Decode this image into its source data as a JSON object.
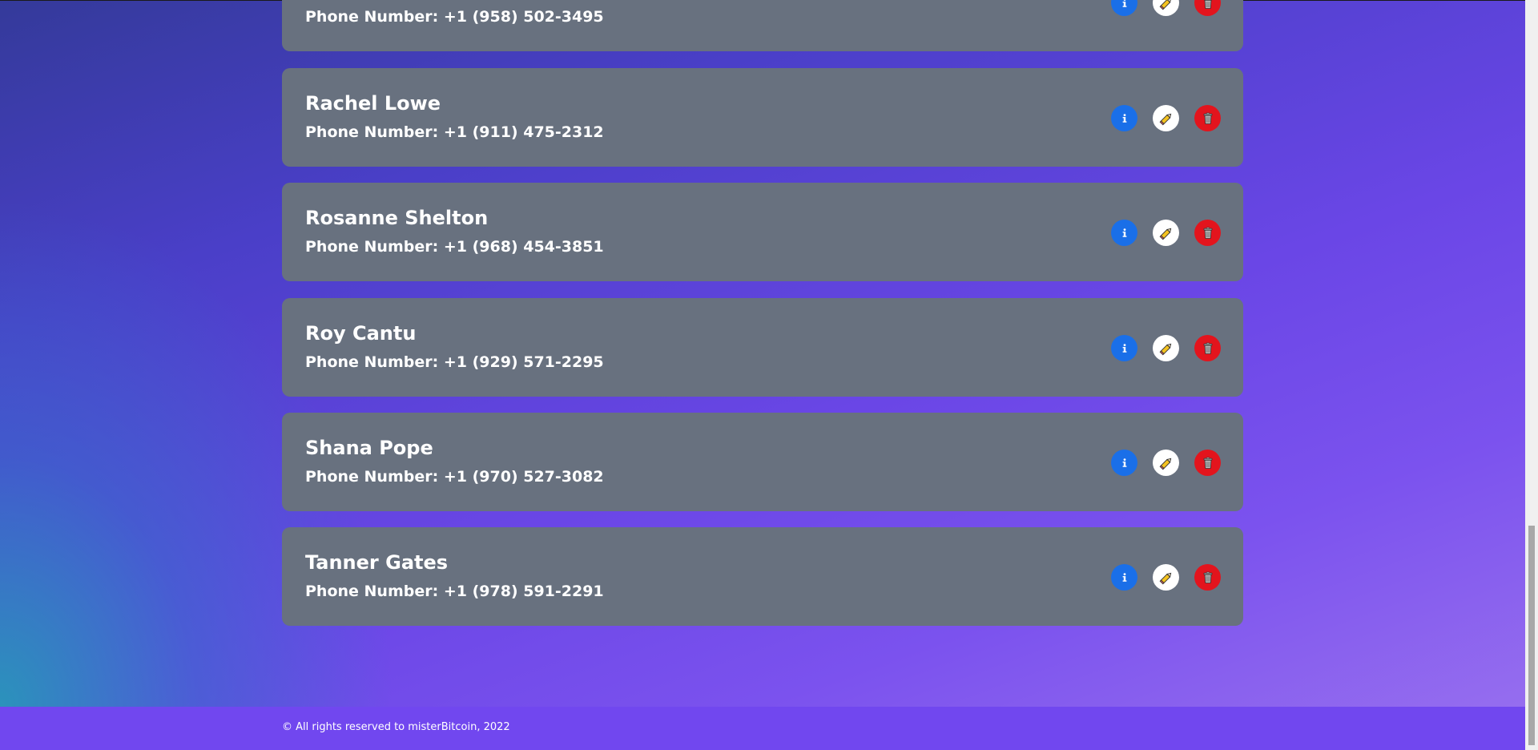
{
  "contacts": [
    {
      "name": "",
      "phone": "Phone Number: +1 (958) 502-3495"
    },
    {
      "name": "Rachel Lowe",
      "phone": "Phone Number: +1 (911) 475-2312"
    },
    {
      "name": "Rosanne Shelton",
      "phone": "Phone Number: +1 (968) 454-3851"
    },
    {
      "name": "Roy Cantu",
      "phone": "Phone Number: +1 (929) 571-2295"
    },
    {
      "name": "Shana Pope",
      "phone": "Phone Number: +1 (970) 527-3082"
    },
    {
      "name": "Tanner Gates",
      "phone": "Phone Number: +1 (978) 591-2291"
    }
  ],
  "icons": {
    "info": "info-icon",
    "edit": "pencil-icon",
    "delete": "trash-icon"
  },
  "colors": {
    "card": "#68717f",
    "info_button": "#1a6fe8",
    "edit_button": "#ffffff",
    "delete_button": "#e3141d",
    "footer": "#7147ef"
  },
  "footer": {
    "copyright": "© All rights reserved to misterBitcoin, 2022"
  }
}
